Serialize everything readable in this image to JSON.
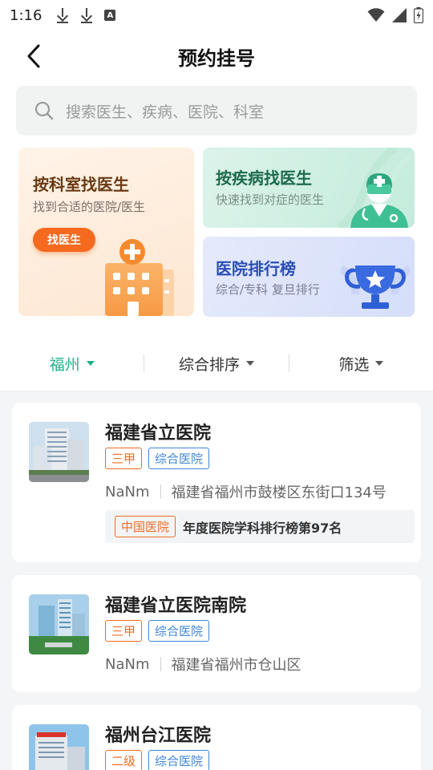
{
  "status_bar": {
    "time": "1:16",
    "left_icons": [
      "download-icon",
      "download-icon",
      "a-icon"
    ],
    "a_icon_label": "A",
    "right_icons": [
      "wifi-icon",
      "signal-icon",
      "battery-icon"
    ]
  },
  "header": {
    "title": "预约挂号",
    "back_icon": "chevron-left-icon"
  },
  "search": {
    "placeholder": "搜索医生、疾病、医院、科室",
    "icon": "search-icon"
  },
  "cards": {
    "dept": {
      "title": "按科室找医生",
      "subtitle": "找到合适的医院/医生",
      "button_label": "找医生",
      "icon": "hospital-building-icon"
    },
    "disease": {
      "title": "按疾病找医生",
      "subtitle": "快速找到对症的医生",
      "icon": "doctor-icon"
    },
    "rank": {
      "title": "医院排行榜",
      "subtitle": "综合/专科 复旦排行",
      "icon": "trophy-icon"
    }
  },
  "filters": [
    {
      "label": "福州",
      "active": true
    },
    {
      "label": "综合排序",
      "active": false
    },
    {
      "label": "筛选",
      "active": false
    }
  ],
  "colors": {
    "accent_green": "#22b08a",
    "tag_orange": "#f06c22",
    "tag_blue": "#3f86d6",
    "find_button": "#f56a1f"
  },
  "hospitals": [
    {
      "name": "福建省立医院",
      "tags": [
        "三甲",
        "综合医院"
      ],
      "distance": "NaNm",
      "address": "福建省福州市鼓楼区东街口134号",
      "rank_tag": "中国医院",
      "rank_text": "年度医院学科排行榜第97名"
    },
    {
      "name": "福建省立医院南院",
      "tags": [
        "三甲",
        "综合医院"
      ],
      "distance": "NaNm",
      "address": "福建省福州市仓山区"
    },
    {
      "name": "福州台江医院",
      "tags": [
        "二级",
        "综合医院"
      ]
    }
  ]
}
